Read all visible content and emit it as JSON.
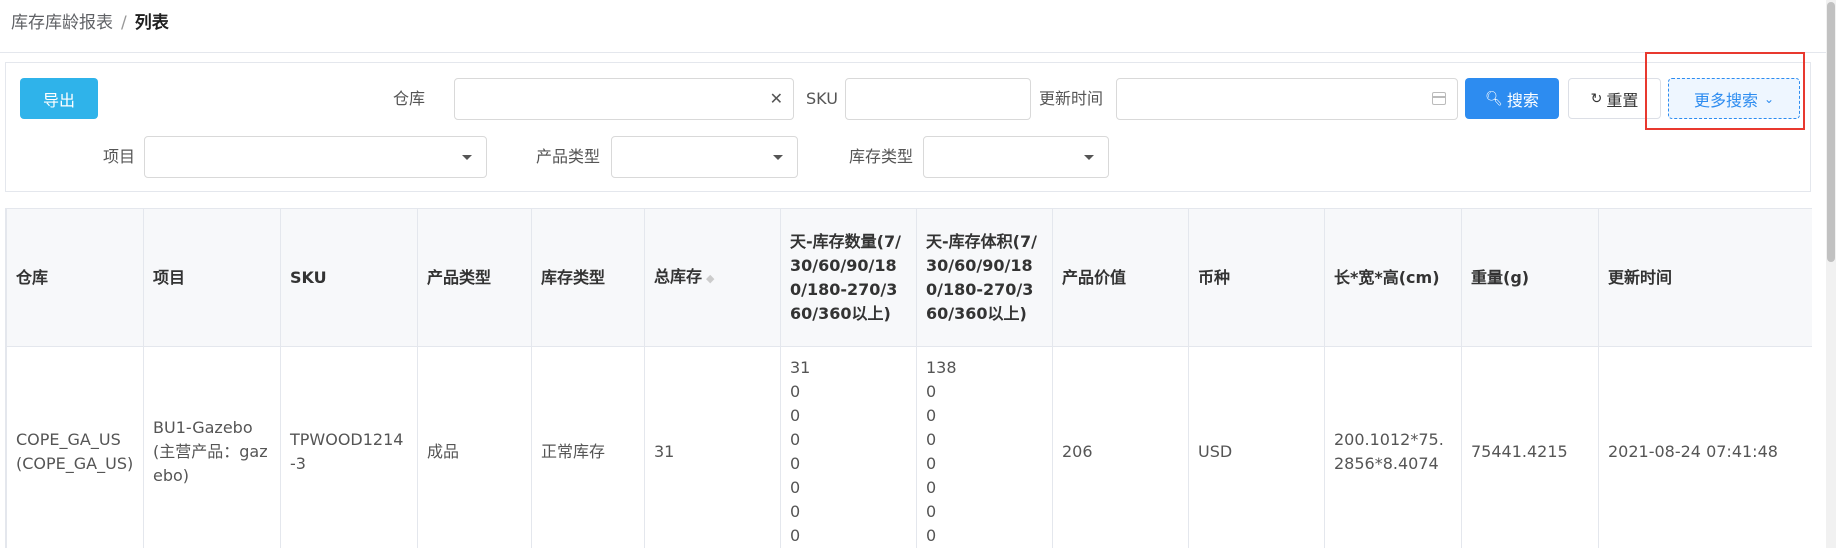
{
  "breadcrumb": {
    "parent": "库存库龄报表",
    "separator": "/",
    "current": "列表"
  },
  "toolbar": {
    "export_label": "导出",
    "search_label": "搜索",
    "reset_label": "重置",
    "more_search_label": "更多搜索"
  },
  "filters": {
    "warehouse": {
      "label": "仓库",
      "value": "",
      "clear_icon": "close-icon"
    },
    "sku": {
      "label": "SKU",
      "value": ""
    },
    "update_time": {
      "label": "更新时间",
      "value": ""
    },
    "project": {
      "label": "项目",
      "value": ""
    },
    "product_type": {
      "label": "产品类型",
      "value": ""
    },
    "stock_type": {
      "label": "库存类型",
      "value": ""
    }
  },
  "highlight_color": "#e8392f",
  "accent_color": "#2d8cf0",
  "table": {
    "headers": [
      "仓库",
      "项目",
      "SKU",
      "产品类型",
      "库存类型",
      "总库存",
      "天-库存数量(7/30/60/90/180/180-270/360/360以上)",
      "天-库存体积(7/30/60/90/180/180-270/360/360以上)",
      "产品价值",
      "币种",
      "长*宽*高(cm)",
      "重量(g)",
      "更新时间"
    ],
    "rows": [
      {
        "warehouse": "COPE_GA_US(COPE_GA_US)",
        "project": "BU1-Gazebo(主营产品：gazebo)",
        "sku": "TPWOOD1214-3",
        "product_type": "成品",
        "stock_type": "正常库存",
        "total_stock": "31",
        "qty_by_days": [
          "31",
          "0",
          "0",
          "0",
          "0",
          "0",
          "0",
          "0"
        ],
        "vol_by_days": [
          "138",
          "0",
          "0",
          "0",
          "0",
          "0",
          "0",
          "0"
        ],
        "product_value": "206",
        "currency": "USD",
        "dimensions": "200.1012*75.2856*8.4074",
        "weight": "75441.4215",
        "updated_at": "2021-08-24 07:41:48"
      }
    ]
  }
}
